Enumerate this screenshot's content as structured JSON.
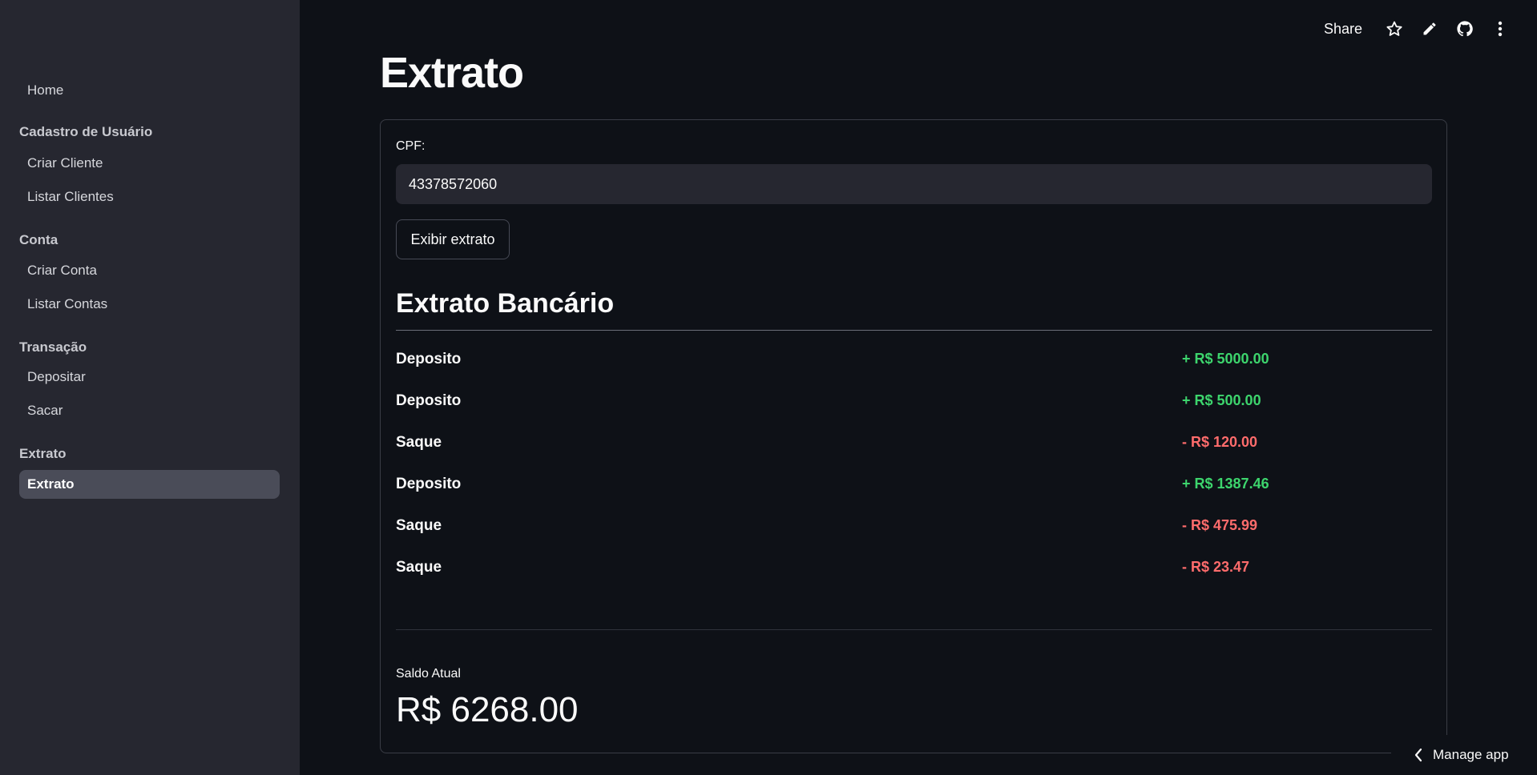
{
  "sidebar": {
    "home": "Home",
    "groups": [
      {
        "title": "Cadastro de Usuário",
        "items": [
          "Criar Cliente",
          "Listar Clientes"
        ]
      },
      {
        "title": "Conta",
        "items": [
          "Criar Conta",
          "Listar Contas"
        ]
      },
      {
        "title": "Transação",
        "items": [
          "Depositar",
          "Sacar"
        ]
      },
      {
        "title": "Extrato",
        "items": [
          "Extrato"
        ]
      }
    ],
    "active_item": "Extrato"
  },
  "toolbar": {
    "share_label": "Share",
    "icons": [
      "star-icon",
      "edit-pencil-icon",
      "github-icon",
      "more-vertical-icon"
    ]
  },
  "page": {
    "title": "Extrato",
    "cpf_label": "CPF:",
    "cpf_value": "43378572060",
    "button_label": "Exibir extrato",
    "statement_title": "Extrato Bancário",
    "transactions": [
      {
        "type": "Deposito",
        "amount": "+ R$ 5000.00",
        "direction": "credit"
      },
      {
        "type": "Deposito",
        "amount": "+ R$ 500.00",
        "direction": "credit"
      },
      {
        "type": "Saque",
        "amount": "- R$ 120.00",
        "direction": "debit"
      },
      {
        "type": "Deposito",
        "amount": "+ R$ 1387.46",
        "direction": "credit"
      },
      {
        "type": "Saque",
        "amount": "- R$ 475.99",
        "direction": "debit"
      },
      {
        "type": "Saque",
        "amount": "- R$ 23.47",
        "direction": "debit"
      }
    ],
    "balance_label": "Saldo Atual",
    "balance_value": "R$ 6268.00"
  },
  "manage_app": {
    "label": "Manage app",
    "icon": "chevron-left-icon"
  },
  "colors": {
    "credit": "#3dd56d",
    "debit": "#ff6c6c",
    "background": "#0e1117",
    "sidebar": "#262730"
  }
}
